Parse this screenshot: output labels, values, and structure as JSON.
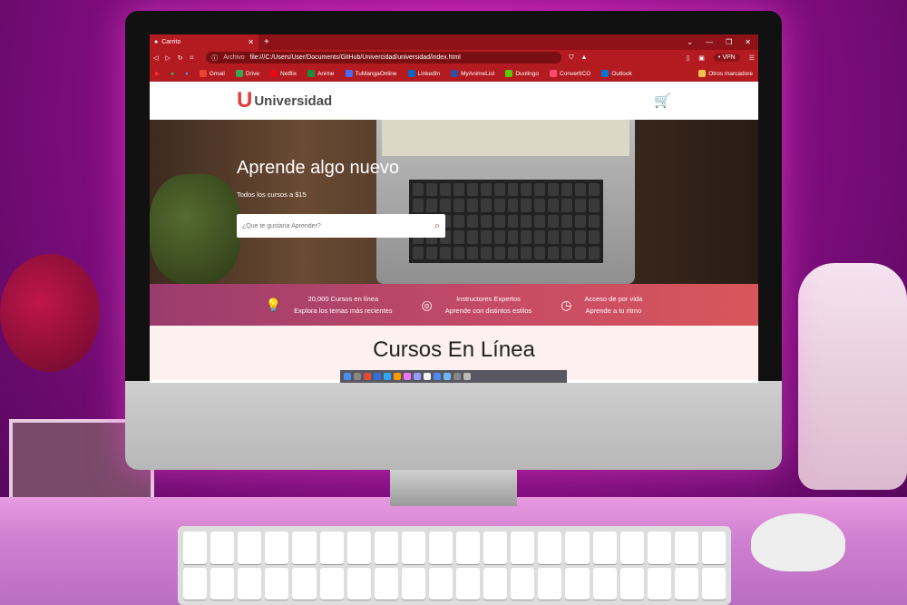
{
  "browser": {
    "tab_title": "Carrito",
    "address_chip": "Archivo",
    "url": "file:///C:/Users/User/Documents/GitHub/Univercidad/universidad/index.html",
    "vpn_label": "• VPN",
    "bookmarks": [
      {
        "label": "Gmail",
        "color": "#ea4335"
      },
      {
        "label": "Drive",
        "color": "#34a853"
      },
      {
        "label": "Netflix",
        "color": "#e50914"
      },
      {
        "label": "Anime",
        "color": "#1b8f3a"
      },
      {
        "label": "TuMangaOnline",
        "color": "#4a6cf7"
      },
      {
        "label": "LinkedIn",
        "color": "#0a66c2"
      },
      {
        "label": "MyAnimeList",
        "color": "#2e51a2"
      },
      {
        "label": "Duolingo",
        "color": "#58cc02"
      },
      {
        "label": "ConvertICO",
        "color": "#ff4a6e"
      },
      {
        "label": "Outlook",
        "color": "#0078d4"
      }
    ],
    "other_bookmarks": "Otros marcadore"
  },
  "site": {
    "logo_letter": "U",
    "logo_name": "Universidad",
    "hero_title": "Aprende algo nuevo",
    "hero_subtitle": "Todos los cursos a $15",
    "search_placeholder": "¿Que te gustaría Aprender?",
    "features": [
      {
        "icon": "lightbulb-icon",
        "line1": "20,000 Cursos en línea",
        "line2": "Explora los temas más recientes"
      },
      {
        "icon": "target-icon",
        "line1": "Instructores Expertos",
        "line2": "Aprende con distintos estilos"
      },
      {
        "icon": "clock-icon",
        "line1": "Acceso de por vida",
        "line2": "Aprende a tu ritmo"
      }
    ],
    "section_title": "Cursos En Línea",
    "colors": {
      "accent": "#e23b3b",
      "browser_red": "#b31b20",
      "banner_start": "#9a3c6e",
      "banner_end": "#d9565a"
    }
  }
}
